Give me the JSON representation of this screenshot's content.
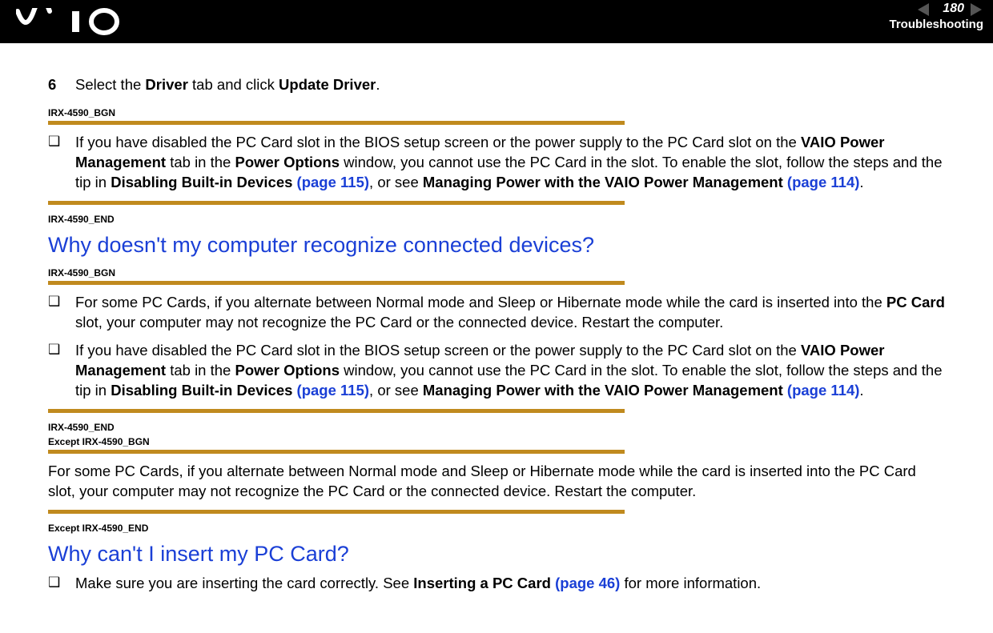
{
  "header": {
    "page_number": "180",
    "section": "Troubleshooting"
  },
  "step": {
    "number": "6",
    "text_prefix": "Select the ",
    "bold1": "Driver",
    "text_mid": " tab and click ",
    "bold2": "Update Driver",
    "text_suffix": "."
  },
  "markers": {
    "bgn": "IRX-4590_BGN",
    "end": "IRX-4590_END",
    "end_except_bgn_line1": "IRX-4590_END",
    "end_except_bgn_line2": "Except IRX-4590_BGN",
    "except_end": "Except IRX-4590_END"
  },
  "bullets": {
    "b1": {
      "p1": "If you have disabled the PC Card slot in the BIOS setup screen or the power supply to the PC Card slot on the ",
      "bold1": "VAIO Power Management",
      "p2": " tab in the ",
      "bold2": "Power Options",
      "p3": " window, you cannot use the PC Card in the slot. To enable the slot, follow the steps and the tip in ",
      "bold3": "Disabling Built-in Devices ",
      "link1": "(page 115)",
      "p4": ", or see ",
      "bold4": "Managing Power with the VAIO Power Management ",
      "link2": "(page 114)",
      "p5": "."
    },
    "b2": {
      "p1": "For some PC Cards, if you alternate between Normal mode and Sleep or Hibernate mode while the card is inserted into the ",
      "bold1": "PC Card",
      "p2": " slot, your computer may not recognize the PC Card or the connected device. Restart the computer."
    },
    "b3": {
      "p1": "If you have disabled the PC Card slot in the BIOS setup screen or the power supply to the PC Card slot on the ",
      "bold1": "VAIO Power Management",
      "p2": " tab in the ",
      "bold2": "Power Options",
      "p3": " window, you cannot use the PC Card in the slot. To enable the slot, follow the steps and the tip in ",
      "bold3": "Disabling Built-in Devices ",
      "link1": "(page 115)",
      "p4": ", or see ",
      "bold4": "Managing Power with the VAIO Power Management ",
      "link2": "(page 114)",
      "p5": "."
    },
    "b4": {
      "p1": "Make sure you are inserting the card correctly. See ",
      "bold1": "Inserting a PC Card ",
      "link1": "(page 46)",
      "p2": " for more information."
    }
  },
  "plain_para": "For some PC Cards, if you alternate between Normal mode and Sleep or Hibernate mode while the card is inserted into the PC Card slot, your computer may not recognize the PC Card or the connected device. Restart the computer.",
  "headings": {
    "h1": "Why doesn't my computer recognize connected devices?",
    "h2": "Why can't I insert my PC Card?"
  }
}
